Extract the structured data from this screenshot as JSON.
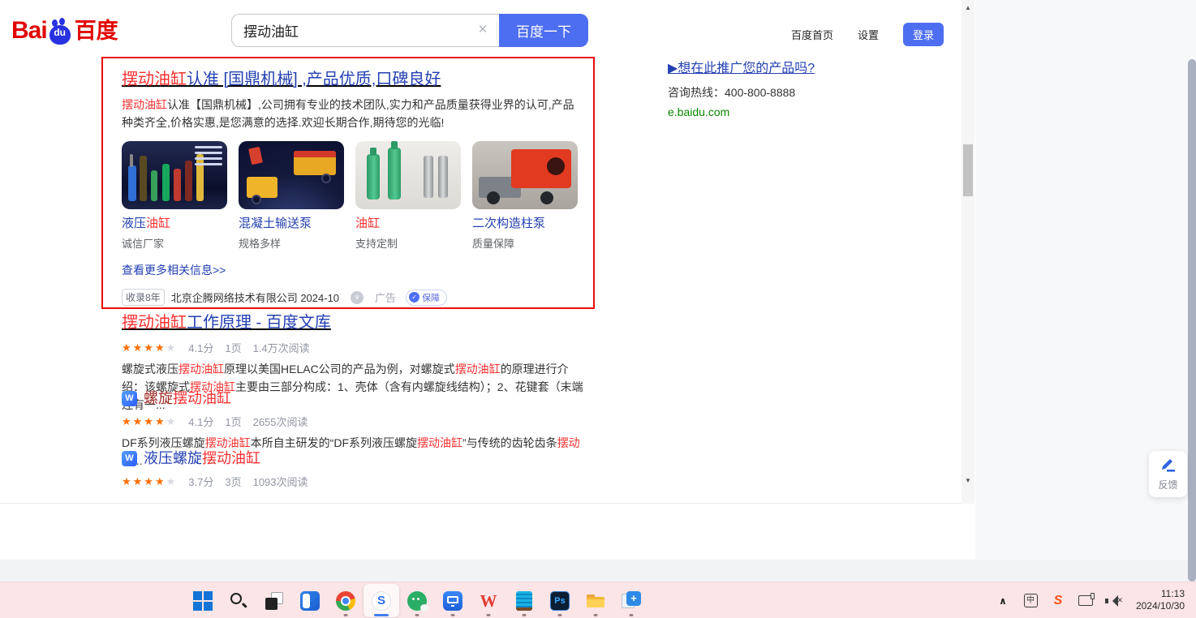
{
  "header": {
    "logo": {
      "bai": "Bai",
      "du": "du",
      "chinese": "百度"
    },
    "search": {
      "value": "摆动油缸",
      "clear_icon": "✕",
      "button_label": "百度一下"
    },
    "nav": {
      "home": "百度首页",
      "settings": "设置",
      "login": "登录"
    }
  },
  "scrollbar": {
    "up_icon": "▲",
    "down_icon": "▼"
  },
  "ad": {
    "title_segments": [
      {
        "t": "摆动油缸",
        "c": "red"
      },
      {
        "t": "认准 [国鼎机械] ,产品优质,口碑良好",
        "c": "blue"
      }
    ],
    "desc_segments": [
      {
        "t": "摆动油缸",
        "c": "red"
      },
      {
        "t": "认准【国鼎机械】,公司拥有专业的技术团队,实力和产品质量获得业界的认可,产品种类齐全,价格实惠,是您满意的选择.欢迎长期合作,期待您的光临!",
        "c": ""
      }
    ],
    "products": [
      {
        "title_segments": [
          {
            "t": "液压",
            "c": "blue"
          },
          {
            "t": "油缸",
            "c": "red"
          }
        ],
        "subtitle": "诚信厂家"
      },
      {
        "title_segments": [
          {
            "t": "混凝土输送泵",
            "c": "blue"
          }
        ],
        "subtitle": "规格多样"
      },
      {
        "title_segments": [
          {
            "t": "油缸",
            "c": "red"
          }
        ],
        "subtitle": "支持定制"
      },
      {
        "title_segments": [
          {
            "t": "二次构造柱泵",
            "c": "blue"
          }
        ],
        "subtitle": "质量保障"
      }
    ],
    "more_link": "查看更多相关信息>>",
    "meta": {
      "badge": "收录8年",
      "company": "北京企腾网络技术有限公司",
      "date": "2024-10",
      "chevron_icon": "∨",
      "ad_label": "广告",
      "check_icon": "✓",
      "guarantee_label": "保障"
    }
  },
  "results": [
    {
      "title_segments": [
        {
          "t": "摆动油缸",
          "c": "red"
        },
        {
          "t": "工作原理 - 百度文库",
          "c": "blue"
        }
      ],
      "rating": "4.1分",
      "stars_pct": "82%",
      "pages": "1页",
      "reads": "1.4万次阅读",
      "desc_segments": [
        {
          "t": "螺旋式液压",
          "c": ""
        },
        {
          "t": "摆动油缸",
          "c": "red"
        },
        {
          "t": "原理以美国HELAC公司的产品为例，对螺旋式",
          "c": ""
        },
        {
          "t": "摆动油缸",
          "c": "red"
        },
        {
          "t": "的原理进行介绍：该螺旋式",
          "c": ""
        },
        {
          "t": "摆动油缸",
          "c": "red"
        },
        {
          "t": "主要由三部分构成：1、壳体（含有内螺旋线结构）；2、花键套（末端连有一...",
          "c": ""
        }
      ]
    },
    {
      "wenku_icon": "W",
      "title_segments": [
        {
          "t": "螺旋",
          "c": "visited"
        },
        {
          "t": "摆动油缸",
          "c": "red"
        }
      ],
      "rating": "4.1分",
      "stars_pct": "82%",
      "pages": "1页",
      "reads": "2655次阅读",
      "desc_segments": [
        {
          "t": "DF系列液压螺旋",
          "c": ""
        },
        {
          "t": "摆动油缸",
          "c": "red"
        },
        {
          "t": "本所自主研发的“DF系列液压螺旋",
          "c": ""
        },
        {
          "t": "摆动油缸",
          "c": "red"
        },
        {
          "t": "”与传统的齿轮齿条",
          "c": ""
        },
        {
          "t": "摆动油",
          "c": "red"
        },
        {
          "t": "...",
          "c": ""
        }
      ]
    },
    {
      "wenku_icon": "W",
      "title_segments": [
        {
          "t": "液压螺旋",
          "c": "blue"
        },
        {
          "t": "摆动油缸",
          "c": "red"
        }
      ],
      "rating": "3.7分",
      "stars_pct": "74%",
      "pages": "3页",
      "reads": "1093次阅读"
    }
  ],
  "stars_glyphs": "★★★★★",
  "sidebar_promo": {
    "title": "▶想在此推广您的产品吗?",
    "hotline": "咨询热线：400-800-8888",
    "url": "e.baidu.com"
  },
  "feedback": {
    "label": "反馈"
  },
  "taskbar": {
    "sogou_glyph": "S",
    "wps_glyph": "W",
    "ps_glyph": "Ps",
    "plus_glyph": "+",
    "tray": {
      "chevron_icon": "∧",
      "ime_label": "中",
      "sogou_glyph": "S",
      "mute_icon": "✕",
      "time": "11:13",
      "date": "2024/10/30"
    }
  }
}
